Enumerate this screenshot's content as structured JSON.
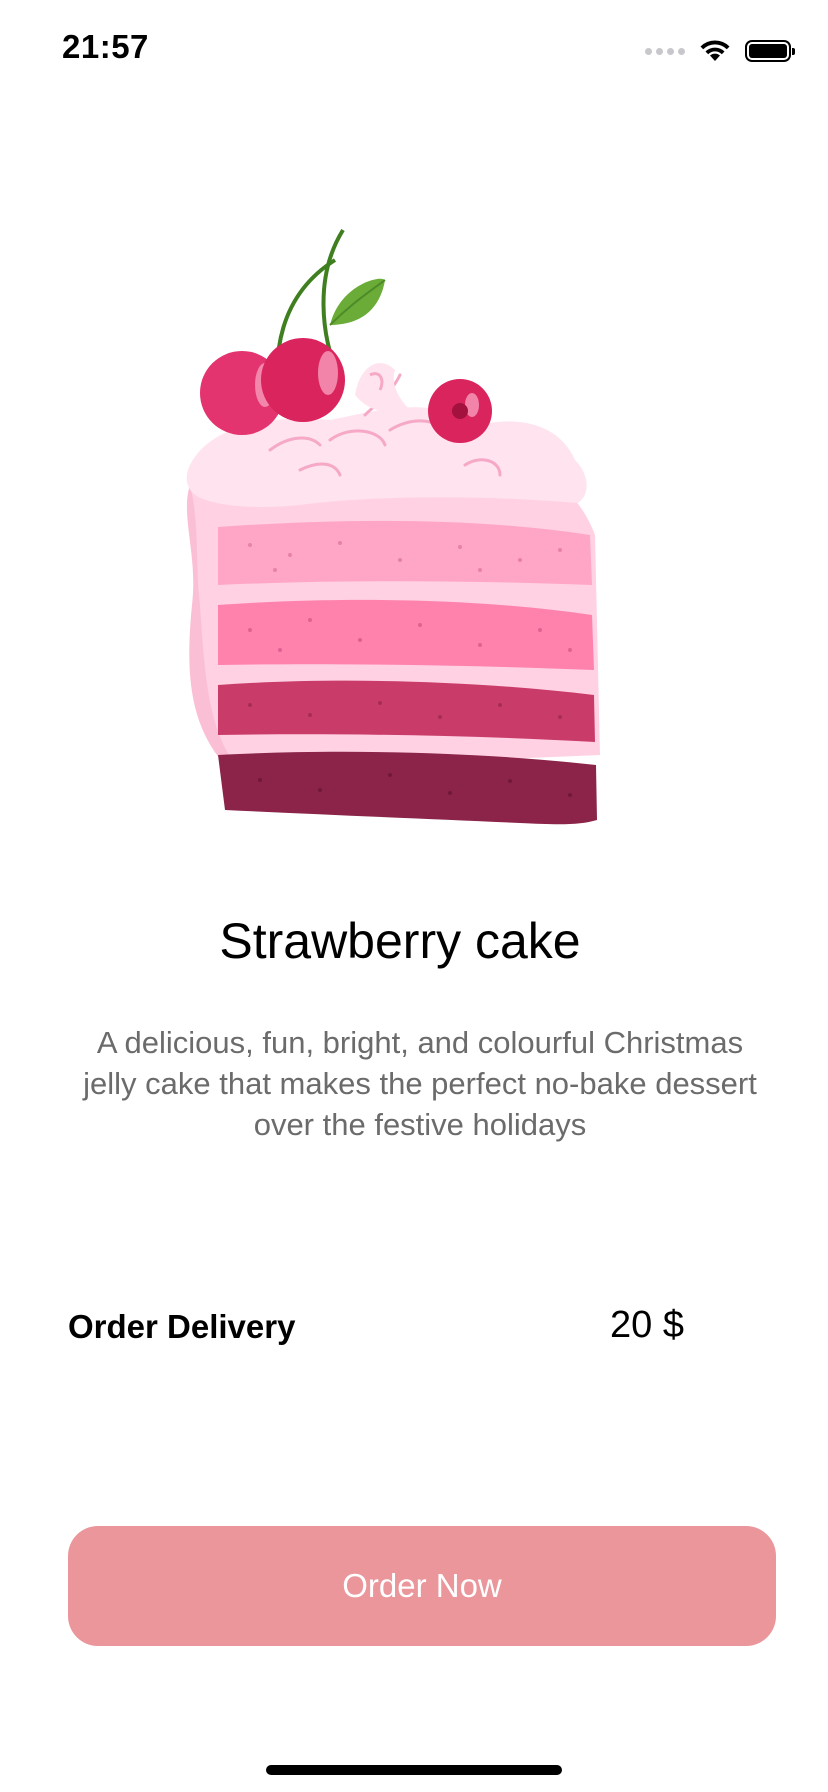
{
  "status_bar": {
    "time": "21:57"
  },
  "product": {
    "image_icon": "strawberry-cake-illustration",
    "title": "Strawberry cake",
    "description": "A delicious, fun, bright, and colourful Christmas jelly cake that makes the perfect no-bake dessert over the festive holidays"
  },
  "delivery": {
    "label": "Order Delivery",
    "price": "20 $"
  },
  "actions": {
    "order_label": "Order Now"
  },
  "colors": {
    "button": "#ea969b",
    "description_text": "#6b6b6b",
    "cake_dark": "#8b2448",
    "cake_mid": "#c93c6a",
    "cake_pink": "#ff82ad",
    "cake_light": "#ffd1e3",
    "cherry": "#e3346f"
  }
}
